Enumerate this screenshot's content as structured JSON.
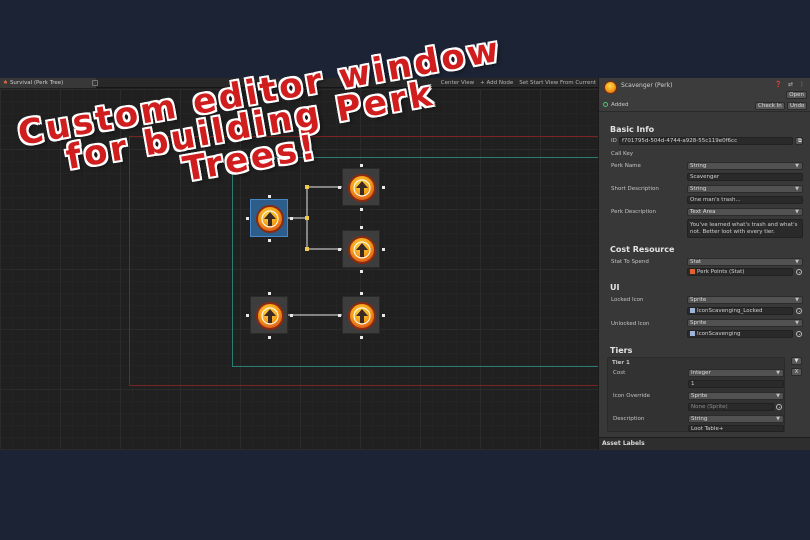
{
  "headline": {
    "line1": "Custom editor window",
    "line2": "for building Perk",
    "line3": "Trees!"
  },
  "editor": {
    "tab_title": "Survival (Perk Tree)",
    "tab_icon": "perk-tree-icon",
    "toolbar": {
      "center_view": "Center View",
      "add_node": "+ Add Node",
      "set_start": "Set Start View From Current"
    }
  },
  "inspector": {
    "title": "Scavenger (Perk)",
    "header_icons": "❓ ⇄ ⋮",
    "open": "Open",
    "added": "Added",
    "check_in": "Check In",
    "undo": "Undo",
    "basic_info": {
      "heading": "Basic Info",
      "id_label": "ID",
      "id_value": "f701795d-504d-4744-a928-55c119e0f6cc",
      "call_key": "Call Key",
      "perk_name_label": "Perk Name",
      "perk_name_type": "String",
      "perk_name_value": "Scavenger",
      "short_desc_label": "Short Description",
      "short_desc_type": "String",
      "short_desc_value": "One man's trash...",
      "perk_desc_label": "Perk Description",
      "perk_desc_type": "Text Area",
      "perk_desc_value": "You've learned what's trash and what's not. Better loot with every tier."
    },
    "cost_resource": {
      "heading": "Cost Resource",
      "stat_label": "Stat To Spend",
      "stat_type": "Stat",
      "stat_value": "Perk Points (Stat)"
    },
    "ui": {
      "heading": "UI",
      "locked_label": "Locked Icon",
      "locked_type": "Sprite",
      "locked_value": "IconScavenging_Locked",
      "unlocked_label": "Unlocked Icon",
      "unlocked_type": "Sprite",
      "unlocked_value": "IconScavenging"
    },
    "tiers": {
      "heading": "Tiers",
      "tier_title": "Tier 1",
      "remove": "X",
      "cost_label": "Cost",
      "cost_type": "Integer",
      "cost_value": "1",
      "icon_override_label": "Icon Override",
      "icon_override_type": "Sprite",
      "icon_override_value": "None (Sprite)",
      "description_label": "Description",
      "description_type": "String",
      "description_value": "Loot Table+"
    },
    "footer": "Asset Labels"
  },
  "colors": {
    "headline_red": "#d01e1e",
    "selected_node": "#2d5d8a",
    "group_red": "#7a2323",
    "group_teal": "#2b7c73",
    "added_green": "#48c774"
  }
}
